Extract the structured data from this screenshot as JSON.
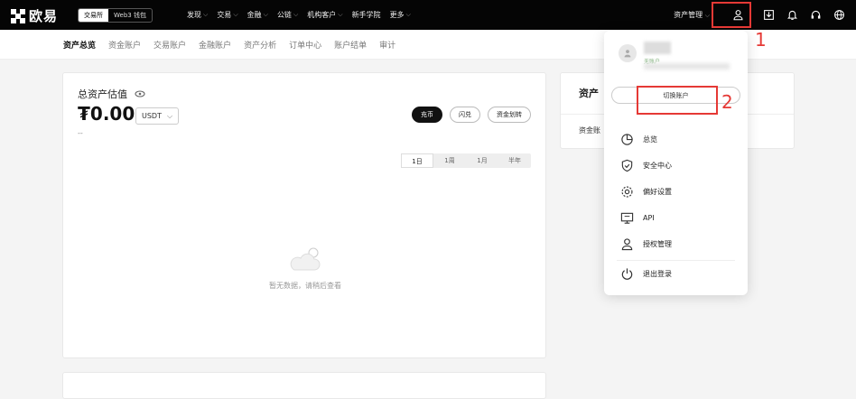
{
  "brand": {
    "name": "欧易"
  },
  "mode_switch": {
    "exchange": "交易所",
    "wallet": "Web3 钱包"
  },
  "nav": [
    {
      "label": "发现"
    },
    {
      "label": "交易"
    },
    {
      "label": "金融"
    },
    {
      "label": "公链"
    },
    {
      "label": "机构客户"
    },
    {
      "label": "新手学院"
    },
    {
      "label": "更多"
    }
  ],
  "topright": {
    "asset_manage": "资产管理"
  },
  "annotations": {
    "one": "1",
    "two": "2"
  },
  "subnav": [
    {
      "label": "资产总览"
    },
    {
      "label": "资金账户"
    },
    {
      "label": "交易账户"
    },
    {
      "label": "金融账户"
    },
    {
      "label": "资产分析"
    },
    {
      "label": "订单中心"
    },
    {
      "label": "账户结单"
    },
    {
      "label": "审计"
    }
  ],
  "overview": {
    "title": "总资产估值",
    "amount": "₮0.00",
    "currency": "USDT",
    "sub": "--",
    "actions": [
      {
        "label": "充币"
      },
      {
        "label": "闪兑"
      },
      {
        "label": "资金划转"
      }
    ],
    "ranges": [
      {
        "label": "1日"
      },
      {
        "label": "1周"
      },
      {
        "label": "1月"
      },
      {
        "label": "半年"
      }
    ],
    "empty_text": "暂无数据，请稍后查看"
  },
  "side_card": {
    "title": "资产",
    "row": "资金账"
  },
  "dropdown": {
    "badge": "无账户",
    "switch_label": "切换账户",
    "items": [
      {
        "label": "总览",
        "icon": "pie-icon"
      },
      {
        "label": "安全中心",
        "icon": "shield-icon"
      },
      {
        "label": "偏好设置",
        "icon": "gear-icon"
      },
      {
        "label": "API",
        "icon": "api-icon"
      },
      {
        "label": "授权管理",
        "icon": "person-icon"
      }
    ],
    "logout": "退出登录"
  },
  "colors": {
    "topbar": "#050505",
    "annotation": "#e53935"
  }
}
